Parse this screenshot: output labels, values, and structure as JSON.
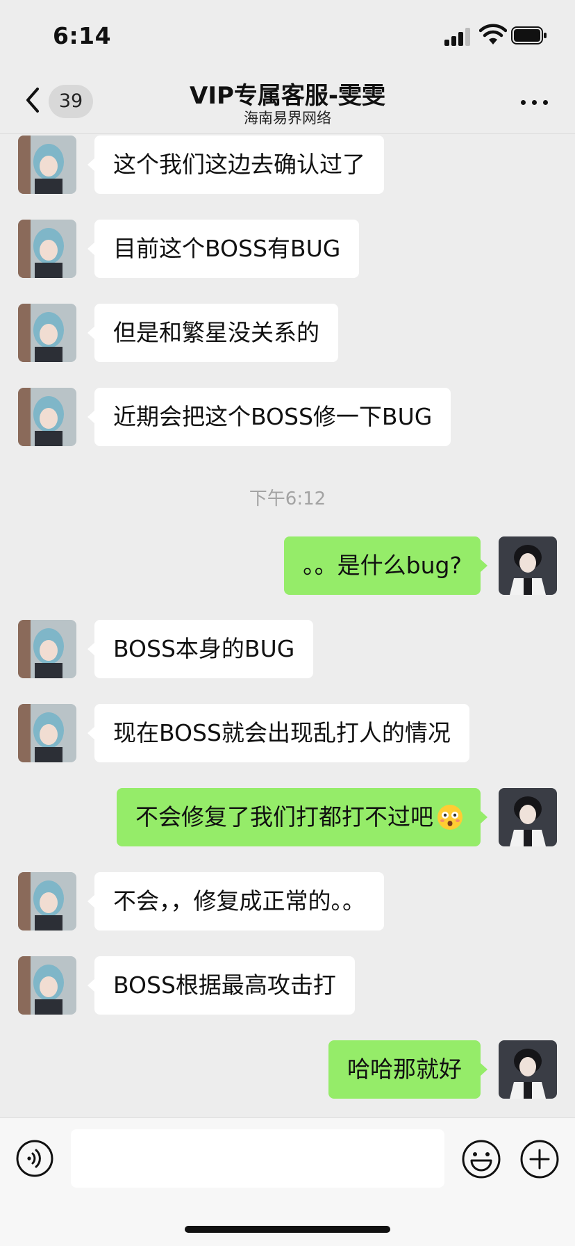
{
  "status_bar": {
    "time": "6:14"
  },
  "nav": {
    "back_badge": "39",
    "title": "VIP专属客服-雯雯",
    "subtitle": "海南易界网络"
  },
  "messages": [
    {
      "side": "left",
      "text": "这个我们这边去确认过了"
    },
    {
      "side": "left",
      "text": "目前这个BOSS有BUG"
    },
    {
      "side": "left",
      "text": "但是和繁星没关系的"
    },
    {
      "side": "left",
      "text": "近期会把这个BOSS修一下BUG"
    },
    {
      "type": "timestamp",
      "text": "下午6:12"
    },
    {
      "side": "right",
      "text": "。。是什么bug?"
    },
    {
      "side": "left",
      "text": "BOSS本身的BUG"
    },
    {
      "side": "left",
      "text": "现在BOSS就会出现乱打人的情况"
    },
    {
      "side": "right",
      "text": "不会修复了我们打都打不过吧",
      "emoji": "flushed-face"
    },
    {
      "side": "left",
      "text": "不会，，修复成正常的。。"
    },
    {
      "side": "left",
      "text": "BOSS根据最高攻击打"
    },
    {
      "side": "right",
      "text": "哈哈那就好"
    }
  ],
  "input_bar": {
    "placeholder": ""
  },
  "colors": {
    "background": "#ededed",
    "incoming_bubble": "#ffffff",
    "outgoing_bubble": "#95ec69",
    "timestamp": "#a3a3a3"
  },
  "icons": [
    "back-chevron-icon",
    "more-dots-icon",
    "voice-icon",
    "emoji-icon",
    "plus-icon",
    "signal-icon",
    "wifi-icon",
    "battery-icon"
  ]
}
